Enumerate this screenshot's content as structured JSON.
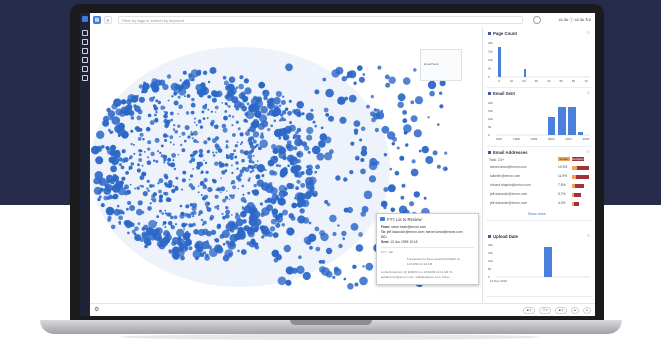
{
  "colors": {
    "background_top": "#262a4b",
    "accent": "#3d7be0",
    "dot_blue": "#2b67c7",
    "sender_orange": "#f2a35b",
    "recipient_red": "#a2323a"
  },
  "topbar": {
    "search_placeholder": "Filter by tags or search by keyword",
    "stats": "41.5k ⓘ 42.5k ↻0"
  },
  "minimap": {
    "label": "Email Sent"
  },
  "panels": {
    "page_count": {
      "title": "Page Count",
      "y_ticks": [
        "20k",
        "15k",
        "10k",
        "5k",
        "0"
      ],
      "x_ticks": [
        "0",
        "10",
        "20",
        "30",
        "40",
        "50",
        "60",
        "70"
      ]
    },
    "email_sent": {
      "title": "Email Sent",
      "y_ticks": [
        "20k",
        "15k",
        "10k",
        "5k",
        "0"
      ],
      "x_ticks": [
        "1997",
        "1998",
        "1999",
        "2000",
        "2001",
        "2002"
      ]
    },
    "email_addresses": {
      "title": "Email Addresses",
      "subtitle": "Total: 2.5+",
      "legend_sender": "Sender",
      "legend_recipient": "Recipient",
      "rows": [
        {
          "email": "steven.kean@enron.com",
          "pct": "10.5%",
          "sender": 0.3,
          "recipient": 0.62
        },
        {
          "email": "sdkeller@enron.com",
          "pct": "11.9%",
          "sender": 0.22,
          "recipient": 0.7
        },
        {
          "email": "richard.shapiro@enron.com",
          "pct": "7.5%",
          "sender": 0.15,
          "recipient": 0.5
        },
        {
          "email": "jeff.dasovich@enron.com",
          "pct": "5.7%",
          "sender": 0.12,
          "recipient": 0.4
        },
        {
          "email": "jeff.dasovich@enron.com",
          "pct": "4.2%",
          "sender": 0.1,
          "recipient": 0.28
        }
      ],
      "show_more": "Show more"
    },
    "upload_date": {
      "title": "Upload Date",
      "y_ticks": [
        "20k",
        "15k",
        "10k",
        "5k",
        "0"
      ],
      "x_tick": "12 Nov 2019"
    }
  },
  "tooltip": {
    "title": "FYI: Lis to Review",
    "from": "steve.kean@enron.com",
    "to": "jeff.dasovich@enron.com; steven.kean@enron.com",
    "cc": "",
    "sent": "13 Jun 1999 10:18",
    "body": [
      "FYI - Jeb",
      "Forwarded by Steve Kean/HOU/EES on",
      "12/13/99 10:14 AM",
      "Linda Robertson @ ENRON on 12/13/99 11:11 AM To",
      "jeffdasovich@enron.com; sdkeller@ees.com; Steve"
    ]
  },
  "bottombar": {
    "buttons": [
      "■ ▾",
      "☷ ▾",
      "■ ▾",
      "▲",
      "●"
    ]
  }
}
